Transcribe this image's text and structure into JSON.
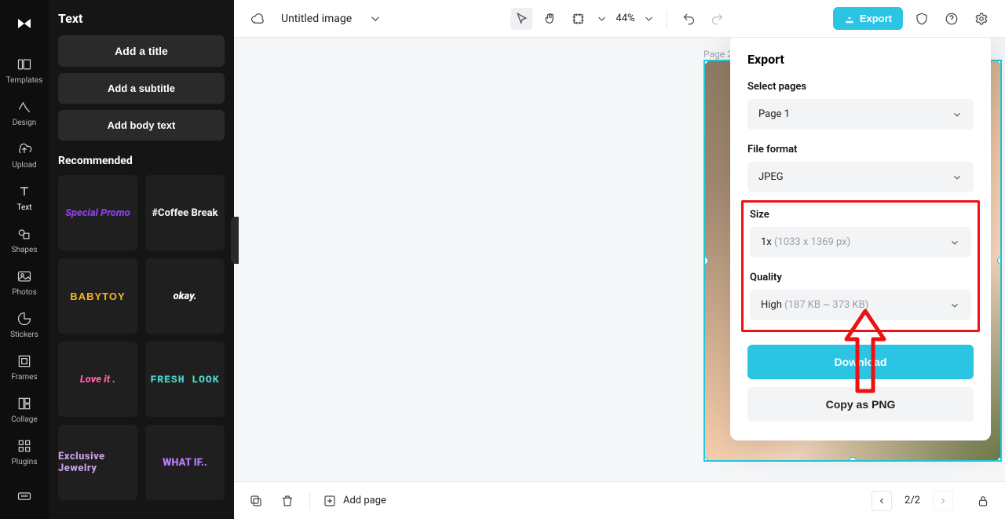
{
  "rail": {
    "templates": "Templates",
    "design": "Design",
    "upload": "Upload",
    "text": "Text",
    "shapes": "Shapes",
    "photos": "Photos",
    "stickers": "Stickers",
    "frames": "Frames",
    "collage": "Collage",
    "plugins": "Plugins"
  },
  "panel": {
    "title": "Text",
    "add_title": "Add a title",
    "add_subtitle": "Add a subtitle",
    "add_body": "Add body text",
    "recommended": "Recommended",
    "thumbs": {
      "promo": "Special Promo",
      "coffee": "#Coffee Break",
      "baby": "BABYTOY",
      "okay": "okay.",
      "love": "Love it .",
      "fresh": "FRESH LOOK",
      "jewel": "Exclusive Jewelry",
      "what": "WHAT IF.."
    }
  },
  "topbar": {
    "title": "Untitled image",
    "zoom": "44%",
    "export": "Export"
  },
  "canvas": {
    "page_label": "Page 2"
  },
  "export": {
    "heading": "Export",
    "select_pages": "Select pages",
    "page_value": "Page 1",
    "file_format_label": "File format",
    "file_format_value": "JPEG",
    "size_label": "Size",
    "size_value": "1x",
    "size_dim": "(1033 x 1369 px)",
    "quality_label": "Quality",
    "quality_value": "High",
    "quality_dim": "(187 KB ~ 373 KB)",
    "download": "Download",
    "copy_png": "Copy as PNG"
  },
  "bottombar": {
    "add_page": "Add page",
    "page_count": "2/2"
  }
}
